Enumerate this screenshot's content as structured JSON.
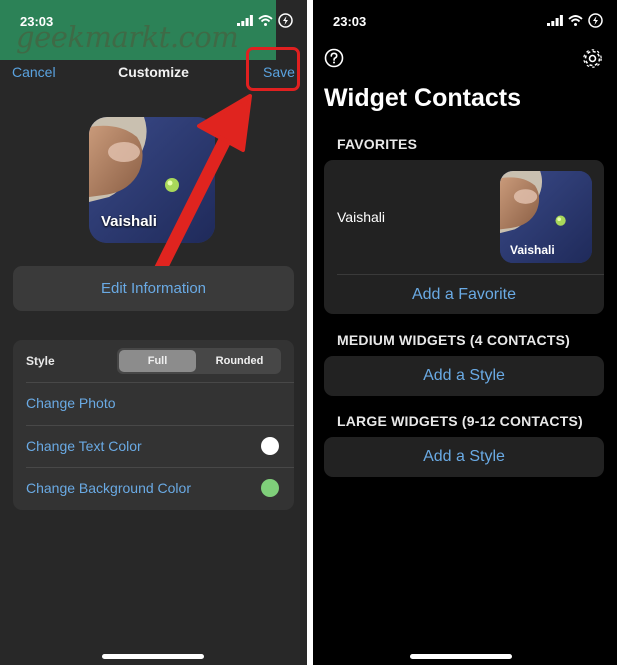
{
  "left": {
    "status_time": "23:03",
    "watermark": "geekmarkt.com",
    "nav": {
      "cancel": "Cancel",
      "title": "Customize",
      "save": "Save"
    },
    "preview_name": "Vaishali",
    "edit_information": "Edit Information",
    "style": {
      "label": "Style",
      "options": [
        "Full",
        "Rounded"
      ],
      "selected": "Full"
    },
    "rows": [
      "Change Photo",
      "Change Text Color",
      "Change Background Color"
    ],
    "colors": {
      "text_color": "#ffffff",
      "background_color": "#7fcf7a",
      "annotation": "#e02020"
    }
  },
  "right": {
    "status_time": "23:03",
    "title": "Widget Contacts",
    "favorites": {
      "header": "FAVORITES",
      "contact_name": "Vaishali",
      "thumb_name": "Vaishali",
      "add": "Add a Favorite"
    },
    "medium": {
      "header": "MEDIUM WIDGETS (4 CONTACTS)",
      "add": "Add a Style"
    },
    "large": {
      "header": "LARGE WIDGETS (9-12 CONTACTS)",
      "add": "Add a Style"
    }
  }
}
